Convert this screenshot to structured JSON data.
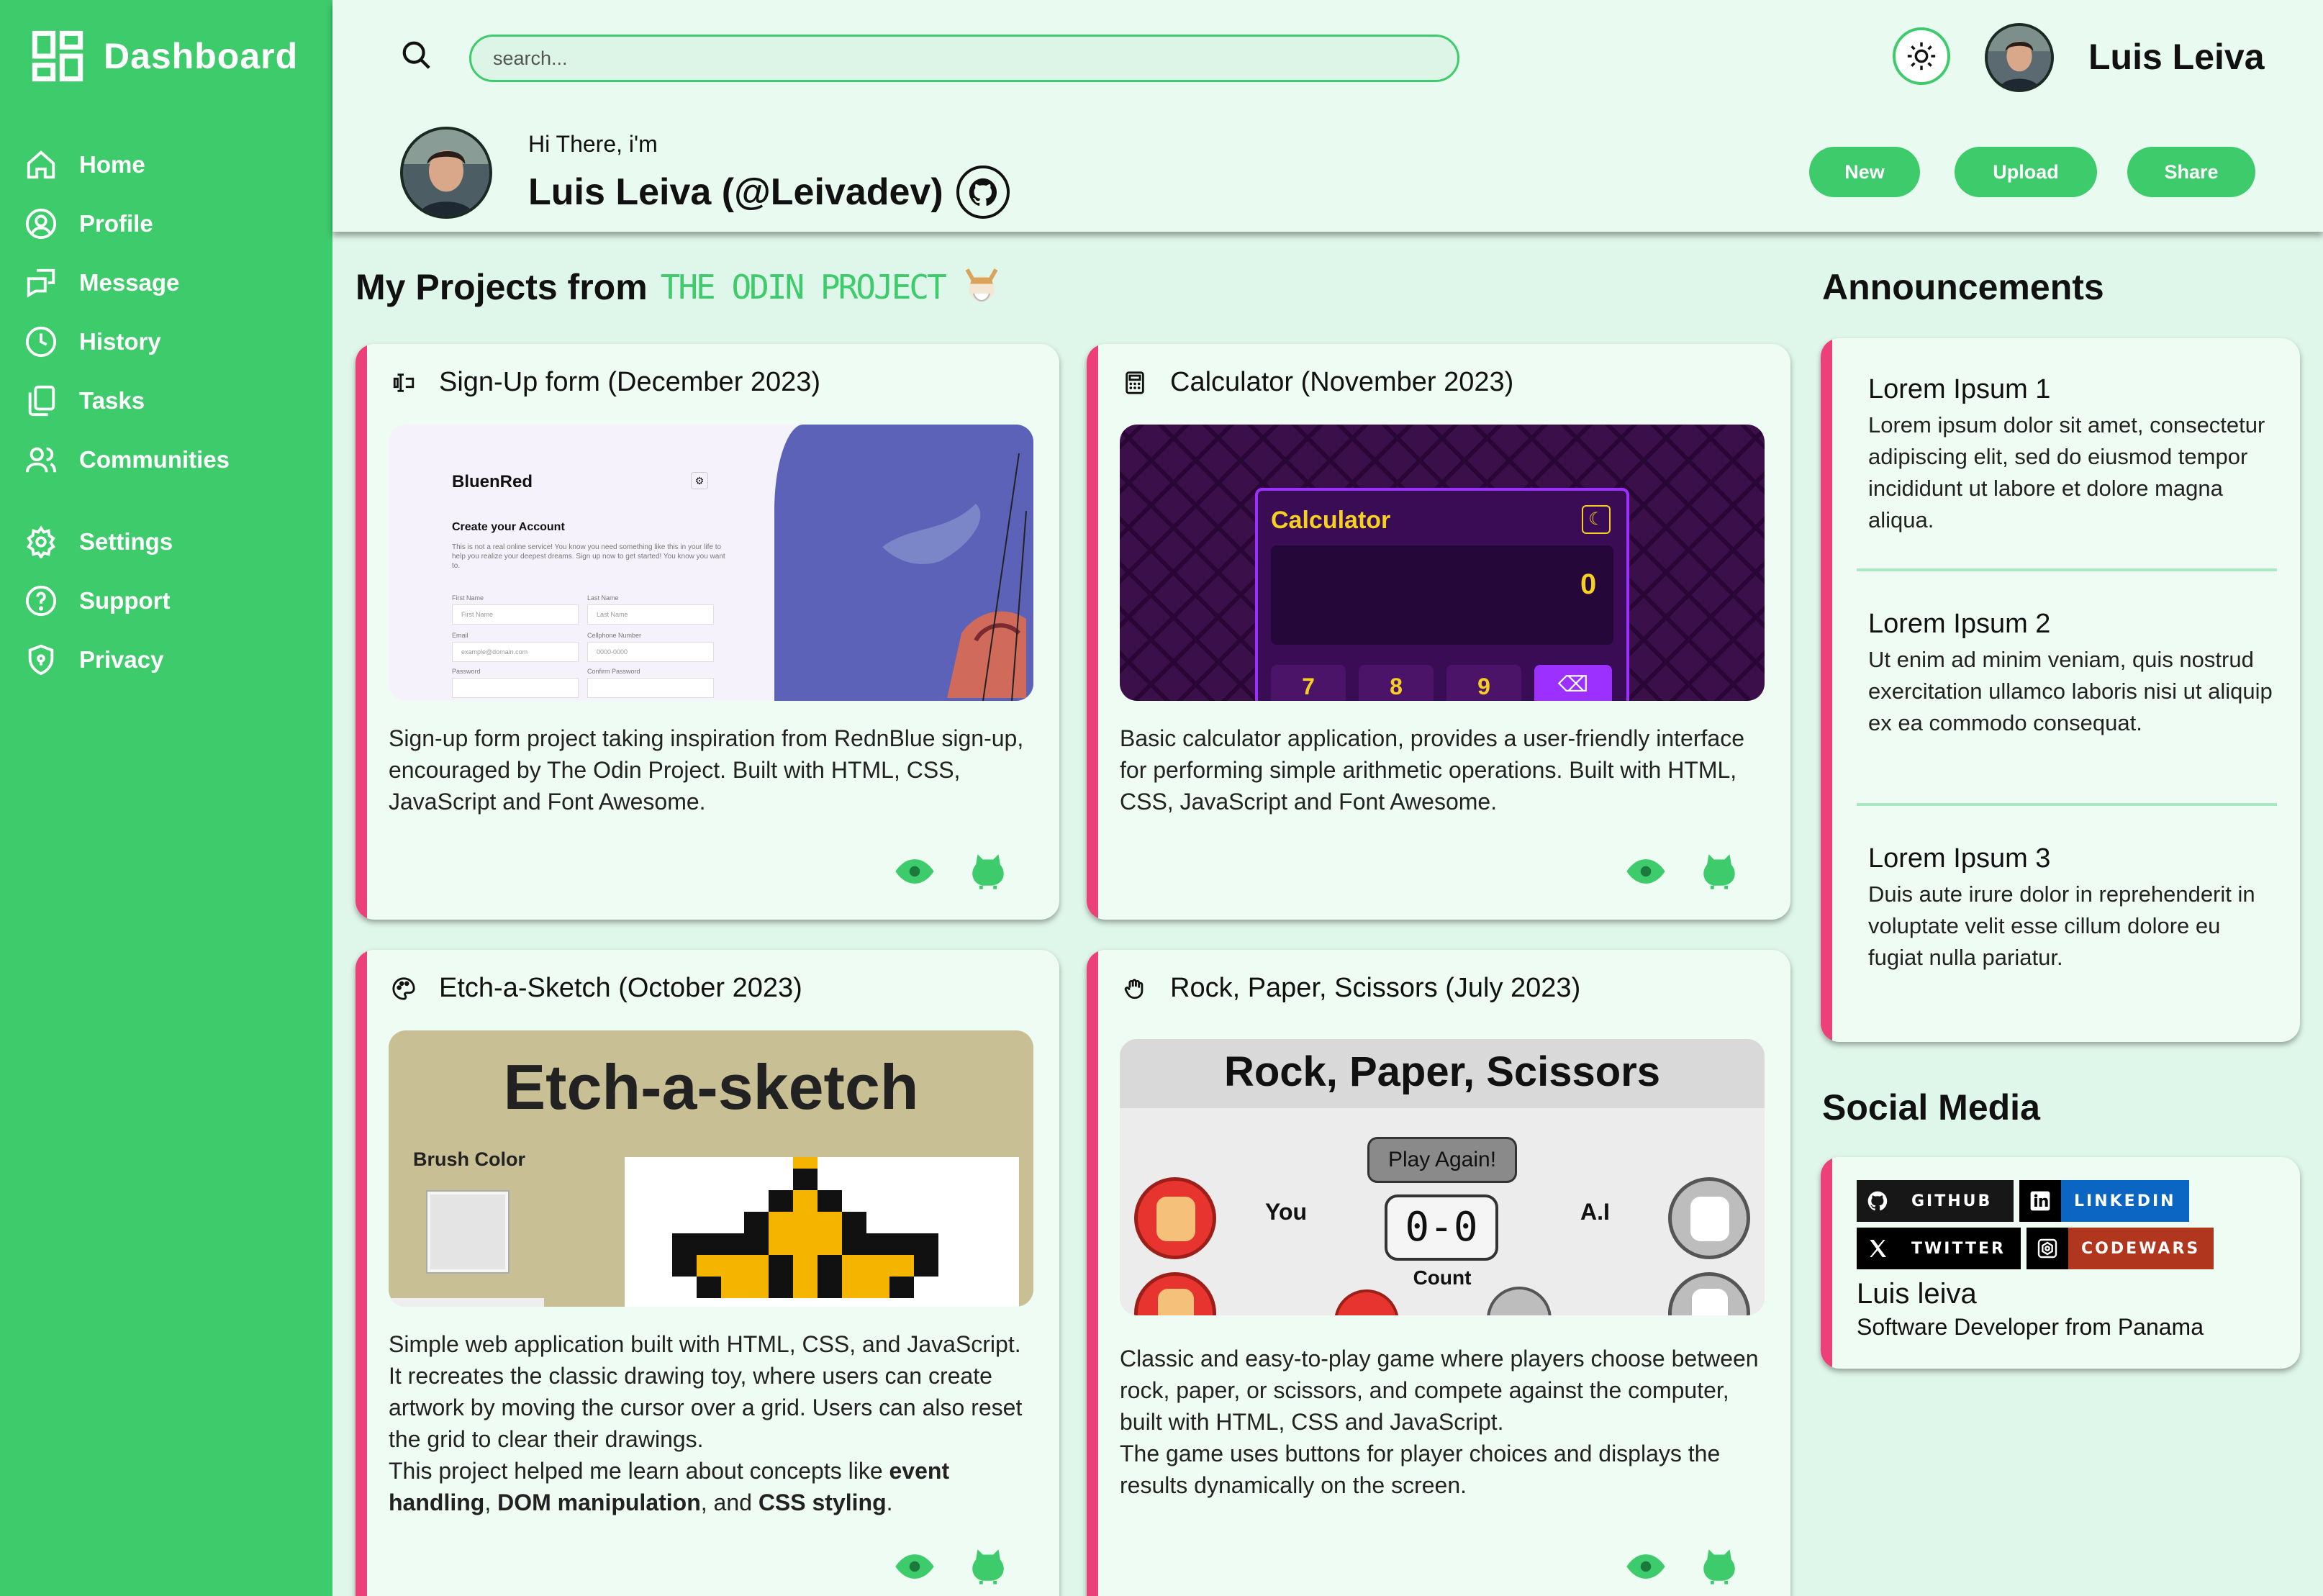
{
  "sidebar": {
    "brand": "Dashboard",
    "items": [
      {
        "label": "Home",
        "icon": "home-icon"
      },
      {
        "label": "Profile",
        "icon": "profile-icon"
      },
      {
        "label": "Message",
        "icon": "message-icon"
      },
      {
        "label": "History",
        "icon": "history-icon"
      },
      {
        "label": "Tasks",
        "icon": "tasks-icon"
      },
      {
        "label": "Communities",
        "icon": "communities-icon"
      }
    ],
    "items2": [
      {
        "label": "Settings",
        "icon": "settings-icon"
      },
      {
        "label": "Support",
        "icon": "support-icon"
      },
      {
        "label": "Privacy",
        "icon": "privacy-icon"
      }
    ]
  },
  "header": {
    "search_placeholder": "search...",
    "user_name": "Luis Leiva",
    "greeting": "Hi There, i'm",
    "full_name": "Luis Leiva (@Leivadev)",
    "buttons": {
      "new": "New",
      "upload": "Upload",
      "share": "Share"
    }
  },
  "projects": {
    "title": "My Projects from",
    "title_brand": "THE ODIN PROJECT",
    "cards": [
      {
        "title": "Sign-Up form (December 2023)",
        "description": "Sign-up form project taking inspiration from RednBlue sign-up, encouraged by The Odin Project. Built with HTML, CSS, JavaScript and Font Awesome.",
        "shot": {
          "logo": "BluenRed",
          "heading": "Create your Account",
          "intro": "This is not a real online service! You know you need something like this in your life to help you realize your deepest dreams. Sign up now to get started! You know you want to.",
          "f1": "First Name",
          "f2": "Last Name",
          "f3": "Email",
          "f4": "Cellphone Number",
          "f5": "Password",
          "f6": "Confirm Password",
          "p1": "First Name",
          "p2": "Last Name",
          "p3": "example@domain.com",
          "p4": "0000-0000"
        }
      },
      {
        "title": "Calculator (November 2023)",
        "description": "Basic calculator application, provides a user-friendly interface for performing simple arithmetic operations. Built with HTML, CSS, JavaScript and Font Awesome.",
        "shot": {
          "title": "Calculator",
          "display": "0",
          "keys": [
            "7",
            "8",
            "9"
          ]
        }
      },
      {
        "title": "Etch-a-Sketch (October 2023)",
        "description": "Simple web application built with HTML, CSS, and JavaScript. It recreates the classic drawing toy, where users can create artwork by moving the cursor over a grid. Users can also reset the grid to clear their drawings.",
        "desc_intro": "This project helped me learn about concepts like",
        "concept1": "event handling",
        "sep1": ",",
        "concept2": "DOM manipulation",
        "sep2": ", and",
        "concept3": "CSS styling",
        "end": ".",
        "shot": {
          "title": "Etch-a-sketch",
          "brush": "Brush Color"
        }
      },
      {
        "title": "Rock, Paper, Scissors (July 2023)",
        "description": "Classic and easy-to-play game where players choose between rock, paper, or scissors, and compete against the computer, built with HTML, CSS and JavaScript.",
        "description2": "The game uses buttons for player choices and displays the results dynamically on the screen.",
        "shot": {
          "title": "Rock, Paper, Scissors",
          "play_again": "Play Again!",
          "you": "You",
          "ai": "A.I",
          "score": "0-0",
          "count": "Count"
        }
      }
    ]
  },
  "announcements": {
    "title": "Announcements",
    "items": [
      {
        "title": "Lorem Ipsum 1",
        "text": "Lorem ipsum dolor sit amet, consectetur adipiscing elit, sed do eiusmod tempor incididunt ut labore et dolore magna aliqua."
      },
      {
        "title": "Lorem Ipsum 2",
        "text": "Ut enim ad minim veniam, quis nostrud exercitation ullamco laboris nisi ut aliquip ex ea commodo consequat."
      },
      {
        "title": "Lorem Ipsum 3",
        "text": "Duis aute irure dolor in reprehenderit in voluptate velit esse cillum dolore eu fugiat nulla pariatur."
      }
    ]
  },
  "social": {
    "title": "Social Media",
    "badges": [
      {
        "label": "GITHUB",
        "color": "#181717"
      },
      {
        "label": "LINKEDIN",
        "color": "#0a66c2"
      },
      {
        "label": "TWITTER",
        "color": "#000000"
      },
      {
        "label": "CODEWARS",
        "color": "#b1361e"
      }
    ],
    "name": "Luis leiva",
    "subtitle": "Software Developer from Panama"
  },
  "colors": {
    "accent": "#3ecb6b",
    "card_border": "#ec407a",
    "background": "#dff7ea"
  }
}
